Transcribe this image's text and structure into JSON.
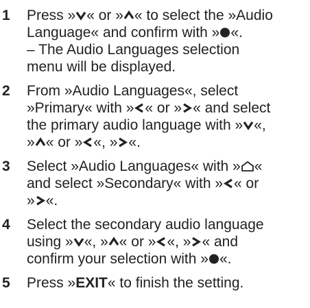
{
  "steps": [
    {
      "number": "1",
      "lines": [
        [
          "Press »",
          "{down-icon}",
          "« or »",
          "{up-icon}",
          "« to select the »Audio"
        ],
        [
          "Language« and confirm with »",
          "{ok-icon}",
          "«."
        ],
        [
          "– The Audio Languages selection"
        ],
        [
          "menu will be displayed."
        ]
      ]
    },
    {
      "number": "2",
      "lines": [
        [
          "From »Audio Languages«, select"
        ],
        [
          "»Primary« with »",
          "{left-icon}",
          "« or »",
          "{right-icon}",
          "« and select"
        ],
        [
          "the primary audio language with »",
          "{down-icon}",
          "«,"
        ],
        [
          "»",
          "{up-icon}",
          "« or »",
          "{left-icon}",
          "«, »",
          "{right-icon}",
          "«."
        ]
      ]
    },
    {
      "number": "3",
      "lines": [
        [
          "Select »Audio Languages« with »",
          "{home-icon}",
          "«"
        ],
        [
          "and select »Secondary« with »",
          "{left-icon}",
          "« or"
        ],
        [
          "»",
          "{right-icon}",
          "«."
        ]
      ]
    },
    {
      "number": "4",
      "lines": [
        [
          "Select the secondary audio language"
        ],
        [
          "using »",
          "{down-icon}",
          "«, »",
          "{up-icon}",
          "« or »",
          "{left-icon}",
          "«, »",
          "{right-icon}",
          "« and"
        ],
        [
          "confirm your selection with »",
          "{ok-icon}",
          "«."
        ]
      ]
    },
    {
      "number": "5",
      "lines": [
        [
          "Press »",
          "{exit-bold}",
          "« to finish the setting."
        ]
      ]
    }
  ],
  "exit_label": "EXIT",
  "colors": {
    "text": "#222222",
    "number": "#222222"
  }
}
